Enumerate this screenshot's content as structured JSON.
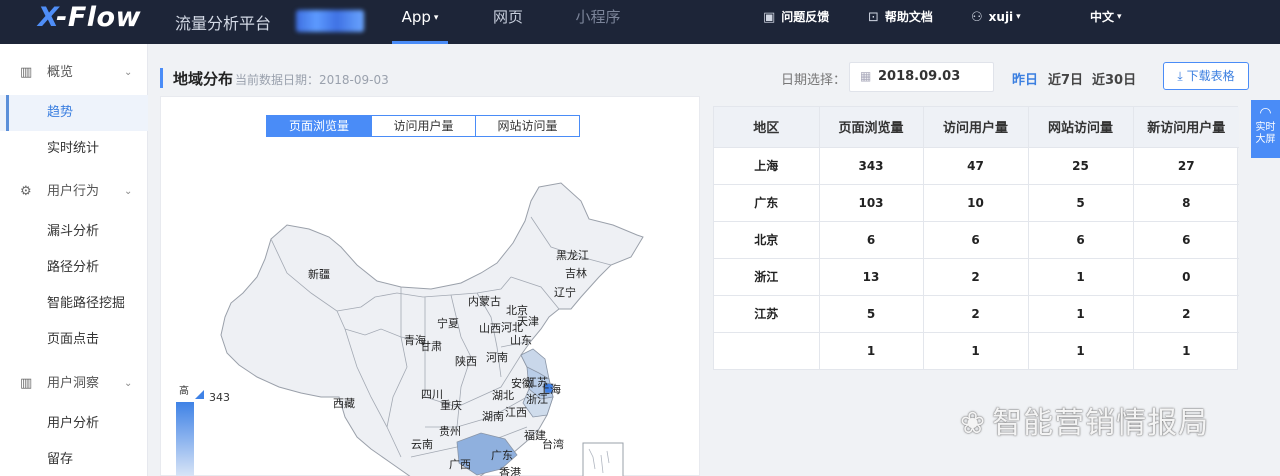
{
  "header": {
    "logo_x": "X",
    "logo_rest": "-Flow",
    "subtitle": "流量分析平台",
    "nav": [
      {
        "label": "App",
        "caret": "▾"
      },
      {
        "label": "网页"
      },
      {
        "label": "小程序"
      }
    ],
    "links": [
      {
        "icon": "▣",
        "label": "问题反馈"
      },
      {
        "icon": "⊡",
        "label": "帮助文档"
      },
      {
        "icon": "⚇",
        "label": "xuji",
        "caret": "▾"
      },
      {
        "label": "中文",
        "caret": "▾"
      }
    ]
  },
  "sidebar": {
    "groups": [
      {
        "icon": "▥",
        "label": "概览",
        "chevron": "⌄",
        "items": [
          "趋势",
          "实时统计"
        ]
      },
      {
        "icon": "⚙",
        "label": "用户行为",
        "chevron": "⌄",
        "items": [
          "漏斗分析",
          "路径分析",
          "智能路径挖掘",
          "页面点击"
        ]
      },
      {
        "icon": "▥",
        "label": "用户洞察",
        "chevron": "⌄",
        "items": [
          "用户分析",
          "留存"
        ]
      }
    ]
  },
  "main": {
    "title": "地域分布",
    "subtitle": "当前数据日期：2018-09-03",
    "date_label": "日期选择：",
    "date_icon": "▦",
    "date_value": "2018.09.03",
    "quick_dates": [
      "昨日",
      "近7日",
      "近30日"
    ],
    "download_icon": "⤓",
    "download_label": "下载表格"
  },
  "map": {
    "tabs": [
      "页面浏览量",
      "访问用户量",
      "网站访问量"
    ],
    "legend_high": "高",
    "legend_max": "343",
    "provinces": [
      "黑龙江",
      "吉林",
      "辽宁",
      "新疆",
      "内蒙古",
      "北京",
      "天津",
      "宁夏",
      "山西",
      "河北",
      "青海",
      "甘肃",
      "山东",
      "陕西",
      "河南",
      "西藏",
      "四川",
      "湖北",
      "安徽",
      "江苏",
      "上海",
      "重庆",
      "浙江",
      "湖南",
      "江西",
      "贵州",
      "福建",
      "云南",
      "台湾",
      "广西",
      "广东",
      "香港"
    ]
  },
  "table": {
    "headers": [
      "地区",
      "页面浏览量",
      "访问用户量",
      "网站访问量",
      "新访问用户量"
    ],
    "rows": [
      [
        "上海",
        "343",
        "47",
        "25",
        "27"
      ],
      [
        "广东",
        "103",
        "10",
        "5",
        "8"
      ],
      [
        "北京",
        "6",
        "6",
        "6",
        "6"
      ],
      [
        "浙江",
        "13",
        "2",
        "1",
        "0"
      ],
      [
        "江苏",
        "5",
        "2",
        "1",
        "2"
      ],
      [
        "",
        "1",
        "1",
        "1",
        "1"
      ]
    ]
  },
  "bigscreen": {
    "icon": "◠",
    "line1": "实时",
    "line2": "大屏"
  },
  "watermark": {
    "icon": "❀",
    "text": "智能营销情报局"
  }
}
